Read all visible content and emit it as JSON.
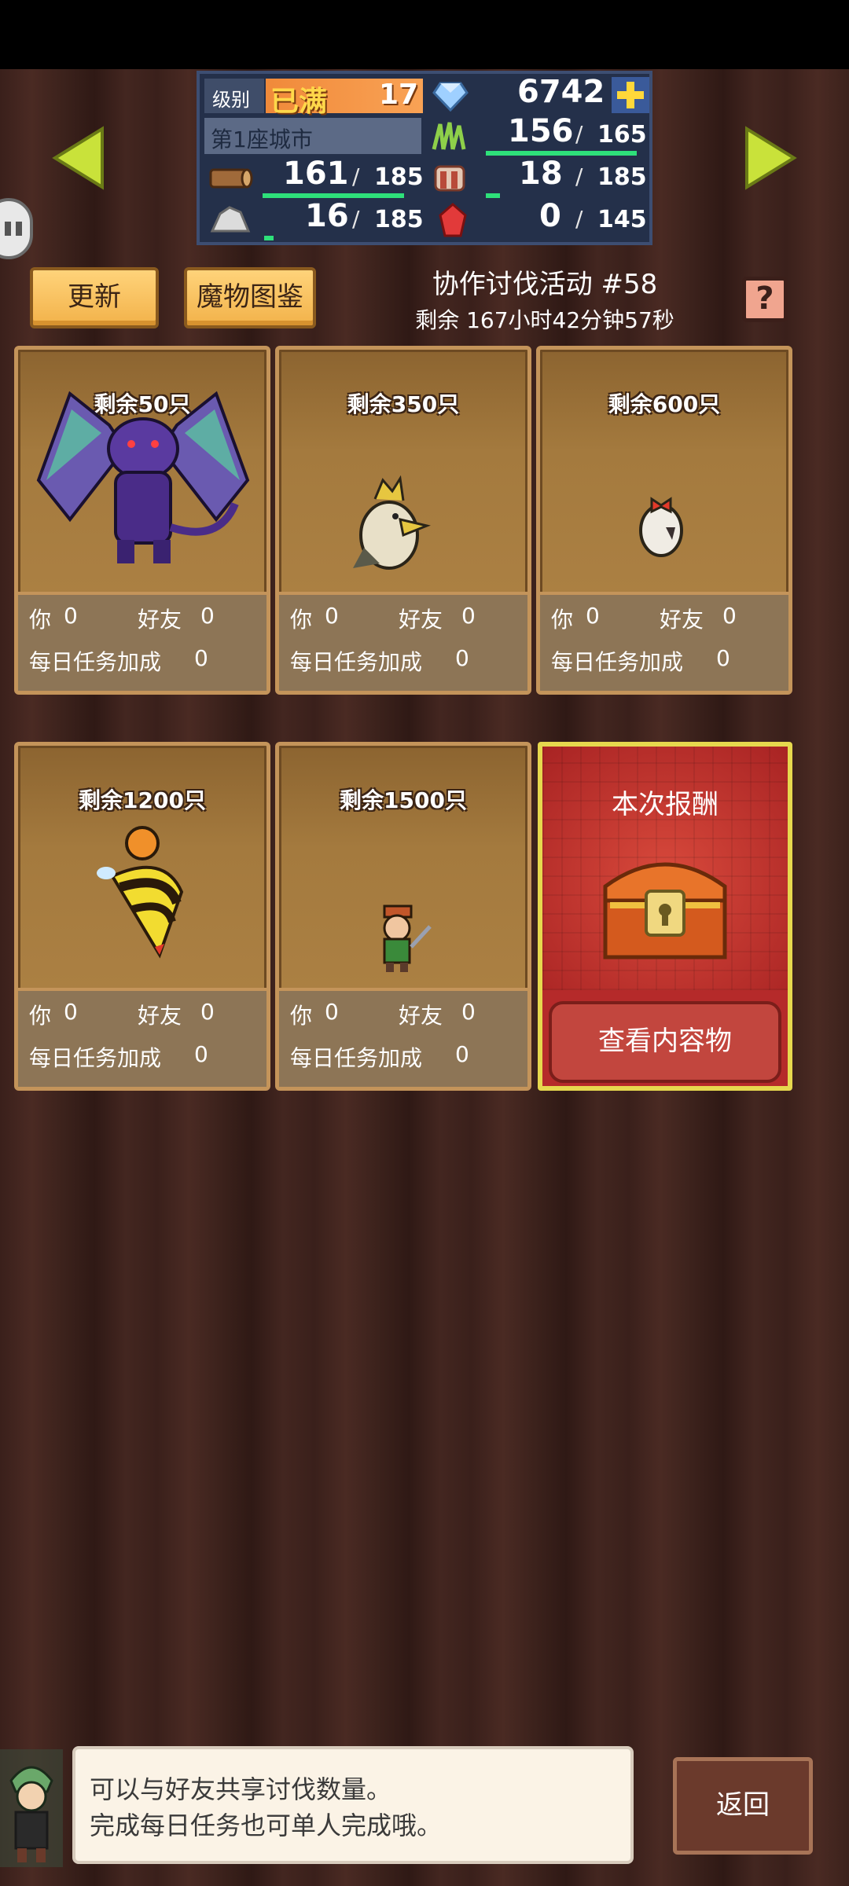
{
  "resources": {
    "level_label": "级别",
    "level_status": "已满",
    "level_value": "17",
    "gems": "6742",
    "city": "第1座城市",
    "green_current": "156",
    "green_max": "165",
    "wood_current": "161",
    "wood_max": "185",
    "food_current": "18",
    "food_max": "185",
    "stone_current": "16",
    "stone_max": "185",
    "ruby_current": "0",
    "ruby_max": "145",
    "slash": "/"
  },
  "header": {
    "update_button": "更新",
    "bestiary_button": "魔物图鉴",
    "event_title": "协作讨伐活动 #58",
    "remaining_time": "剩余 167小时42分钟57秒",
    "help_icon_text": "?"
  },
  "cards": [
    {
      "remaining": "剩余50只",
      "you_label": "你",
      "you_value": "0",
      "friend_label": "好友",
      "friend_value": "0",
      "daily_label": "每日任务加成",
      "daily_value": "0",
      "monster": "purple-dragon-icon"
    },
    {
      "remaining": "剩余350只",
      "you_label": "你",
      "you_value": "0",
      "friend_label": "好友",
      "friend_value": "0",
      "daily_label": "每日任务加成",
      "daily_value": "0",
      "monster": "ghost-bird-icon"
    },
    {
      "remaining": "剩余600只",
      "you_label": "你",
      "you_value": "0",
      "friend_label": "好友",
      "friend_value": "0",
      "daily_label": "每日任务加成",
      "daily_value": "0",
      "monster": "egg-bow-icon"
    },
    {
      "remaining": "剩余1200只",
      "you_label": "你",
      "you_value": "0",
      "friend_label": "好友",
      "friend_value": "0",
      "daily_label": "每日任务加成",
      "daily_value": "0",
      "monster": "bee-icon"
    },
    {
      "remaining": "剩余1500只",
      "you_label": "你",
      "you_value": "0",
      "friend_label": "好友",
      "friend_value": "0",
      "daily_label": "每日任务加成",
      "daily_value": "0",
      "monster": "goblin-icon"
    }
  ],
  "reward": {
    "title": "本次报酬",
    "view_button": "查看内容物"
  },
  "dialog": {
    "line1": "可以与好友共享讨伐数量。",
    "line2": "完成每日任务也可单人完成哦。"
  },
  "back_button": "返回"
}
